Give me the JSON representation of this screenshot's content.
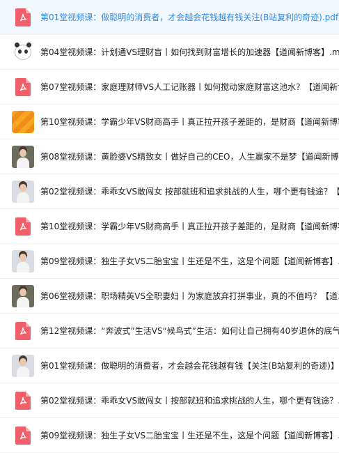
{
  "files": [
    {
      "name": "第01堂视频课：做聪明的消费者，才会越会花钱越有钱关注(B站复利的奇迹).pdf",
      "icon": "pdf-icon",
      "active": true
    },
    {
      "name": "第04堂视频课：计划通VS理财盲丨如何找到财富增长的加速器【道闻新博客】.m",
      "icon": "panda-icon"
    },
    {
      "name": "第07堂视频课：家庭理财师VS人工记账器丨如何搅动家庭财富这池水？【道闻新博",
      "icon": "pdf-icon"
    },
    {
      "name": "第10堂视频课：学霸少年VS财商高手丨真正拉开孩子差距的，是财商【道闻新博客",
      "icon": "folder-icon"
    },
    {
      "name": "第08堂视频课：黄脸婆VS精致女丨做好自己的CEO，人生赢家不是梦【道闻新博",
      "icon": "video-thumbnail-icon",
      "dark": true
    },
    {
      "name": "第02堂视频课：乖乖女VS敢闯女 按部就班和追求挑战的人生，哪个更有钱途？【",
      "icon": "video-thumbnail-icon"
    },
    {
      "name": "第10堂视频课：学霸少年VS财商高手丨真正拉开孩子差距的，是财商【道闻新博客",
      "icon": "pdf-icon"
    },
    {
      "name": "第09堂视频课：独生子女VS二胎宝宝丨生还是不生，这是个问题【道闻新博客】.",
      "icon": "video-thumbnail-icon"
    },
    {
      "name": "第06堂视频课：职场精英VS全职妻妇丨为家庭放弃打拼事业，真的不值吗？【道.",
      "icon": "video-thumbnail-icon",
      "dark": true
    },
    {
      "name": "第12堂视频课：“奔波式”生活VS“候鸟式”生活：如何让自己拥有40岁退休的底气.",
      "icon": "pdf-icon"
    },
    {
      "name": "第01堂视频课：做聪明的消费者，才会越会花钱越有钱【关注(B站复利的奇迹)】.",
      "icon": "video-thumbnail-icon"
    },
    {
      "name": "第02堂视频课：乖乖女VS敢闯女丨按部就班和追求挑战的人生，哪个更有钱途？.",
      "icon": "pdf-icon"
    },
    {
      "name": "第09堂视频课：独生子女VS二胎宝宝丨生还是不生，这是个问题【道闻新博客】.",
      "icon": "pdf-icon"
    }
  ],
  "colors": {
    "accent": "#2f8ae5",
    "pdf": "#f0606a",
    "active_bg": "#f2f8ff"
  }
}
